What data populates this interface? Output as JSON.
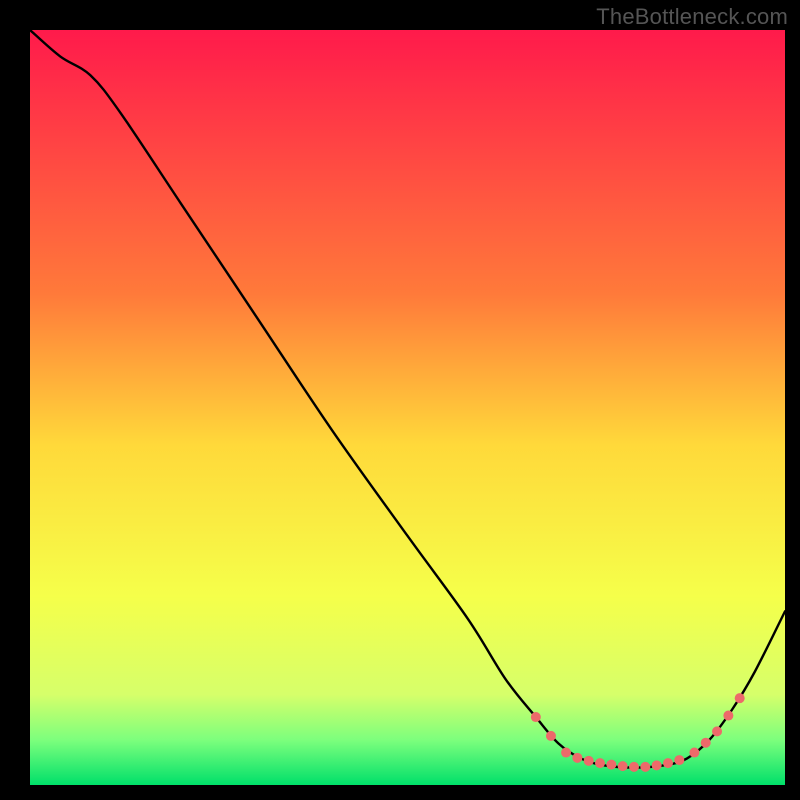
{
  "watermark": "TheBottleneck.com",
  "chart_data": {
    "type": "line",
    "title": "",
    "xlabel": "",
    "ylabel": "",
    "xlim": [
      0,
      100
    ],
    "ylim": [
      0,
      100
    ],
    "gradient_stops": [
      {
        "offset": 0,
        "color": "#ff1a4b"
      },
      {
        "offset": 35,
        "color": "#ff7a3a"
      },
      {
        "offset": 55,
        "color": "#ffd93a"
      },
      {
        "offset": 75,
        "color": "#f5ff4a"
      },
      {
        "offset": 88,
        "color": "#d6ff6a"
      },
      {
        "offset": 94,
        "color": "#7dff7d"
      },
      {
        "offset": 100,
        "color": "#00e06a"
      }
    ],
    "curve": [
      {
        "x": 0,
        "y": 100
      },
      {
        "x": 4,
        "y": 96.5
      },
      {
        "x": 8,
        "y": 94
      },
      {
        "x": 12,
        "y": 89
      },
      {
        "x": 20,
        "y": 77
      },
      {
        "x": 30,
        "y": 62
      },
      {
        "x": 40,
        "y": 47
      },
      {
        "x": 50,
        "y": 33
      },
      {
        "x": 58,
        "y": 22
      },
      {
        "x": 63,
        "y": 14
      },
      {
        "x": 67,
        "y": 9
      },
      {
        "x": 70,
        "y": 5.5
      },
      {
        "x": 73,
        "y": 3.5
      },
      {
        "x": 76,
        "y": 2.6
      },
      {
        "x": 80,
        "y": 2.3
      },
      {
        "x": 84,
        "y": 2.6
      },
      {
        "x": 87,
        "y": 3.5
      },
      {
        "x": 90,
        "y": 6
      },
      {
        "x": 93,
        "y": 10
      },
      {
        "x": 96,
        "y": 15
      },
      {
        "x": 100,
        "y": 23
      }
    ],
    "markers": [
      {
        "x": 67,
        "y": 9
      },
      {
        "x": 69,
        "y": 6.5
      },
      {
        "x": 71,
        "y": 4.3
      },
      {
        "x": 72.5,
        "y": 3.6
      },
      {
        "x": 74,
        "y": 3.2
      },
      {
        "x": 75.5,
        "y": 2.9
      },
      {
        "x": 77,
        "y": 2.7
      },
      {
        "x": 78.5,
        "y": 2.5
      },
      {
        "x": 80,
        "y": 2.4
      },
      {
        "x": 81.5,
        "y": 2.4
      },
      {
        "x": 83,
        "y": 2.6
      },
      {
        "x": 84.5,
        "y": 2.9
      },
      {
        "x": 86,
        "y": 3.3
      },
      {
        "x": 88,
        "y": 4.3
      },
      {
        "x": 89.5,
        "y": 5.6
      },
      {
        "x": 91,
        "y": 7.1
      },
      {
        "x": 92.5,
        "y": 9.2
      },
      {
        "x": 94,
        "y": 11.5
      }
    ],
    "marker_color": "#ed6a6a",
    "marker_radius": 5,
    "line_color": "#000000",
    "line_width": 2.4
  }
}
